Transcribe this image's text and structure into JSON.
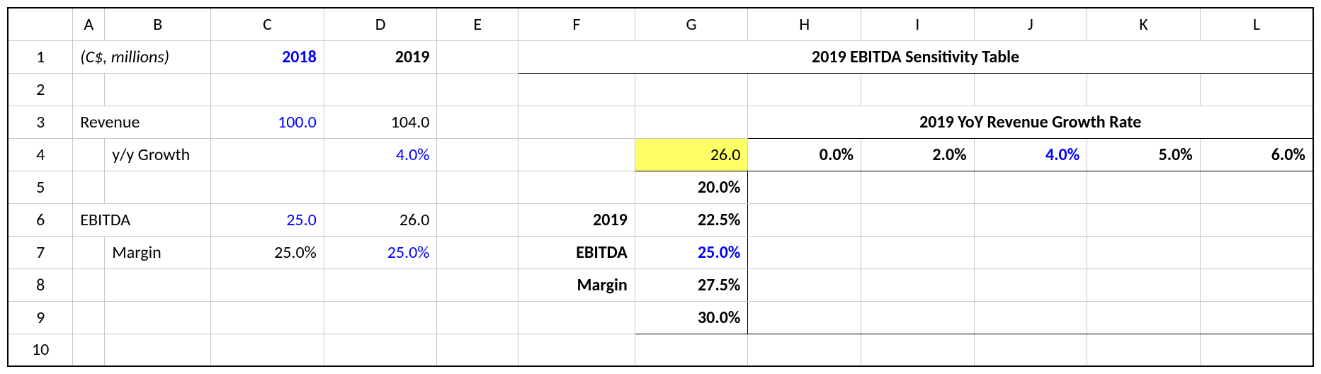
{
  "columns": [
    "A",
    "B",
    "C",
    "D",
    "E",
    "F",
    "G",
    "H",
    "I",
    "J",
    "K",
    "L"
  ],
  "rows": [
    "1",
    "2",
    "3",
    "4",
    "5",
    "6",
    "7",
    "8",
    "9",
    "10"
  ],
  "r1": {
    "units_label": "(C$, millions)",
    "y2018": "2018",
    "y2019": "2019",
    "sens_title": "2019 EBITDA Sensitivity Table"
  },
  "r3": {
    "revenue_label": "Revenue",
    "rev_2018": "100.0",
    "rev_2019": "104.0",
    "growth_title": "2019 YoY Revenue Growth Rate"
  },
  "r4": {
    "yoy_label": "y/y Growth",
    "yoy_2019": "4.0%",
    "base_ebitda": "26.0",
    "h0": "0.0%",
    "h1": "2.0%",
    "h2": "4.0%",
    "h3": "5.0%",
    "h4": "6.0%"
  },
  "r5": {
    "m0": "20.0%"
  },
  "r6": {
    "ebitda_label": "EBITDA",
    "ebitda_2018": "25.0",
    "ebitda_2019": "26.0",
    "f": "2019",
    "m1": "22.5%"
  },
  "r7": {
    "margin_label": "Margin",
    "margin_2018": "25.0%",
    "margin_2019": "25.0%",
    "f": "EBITDA",
    "m2": "25.0%"
  },
  "r8": {
    "f": "Margin",
    "m3": "27.5%"
  },
  "r9": {
    "m4": "30.0%"
  },
  "chart_data": {
    "type": "table",
    "title": "2019 EBITDA Sensitivity Table",
    "base_ebitda": 26.0,
    "col_axis_label": "2019 YoY Revenue Growth Rate",
    "columns": [
      "0.0%",
      "2.0%",
      "4.0%",
      "5.0%",
      "6.0%"
    ],
    "row_axis_label": "2019 EBITDA Margin",
    "rows": [
      "20.0%",
      "22.5%",
      "25.0%",
      "27.5%",
      "30.0%"
    ],
    "values": null,
    "revenue": {
      "2018": 100.0,
      "2019": 104.0,
      "yoy_growth": "4.0%"
    },
    "ebitda": {
      "2018": 25.0,
      "2019": 26.0,
      "margin_2018": "25.0%",
      "margin_2019": "25.0%"
    }
  }
}
